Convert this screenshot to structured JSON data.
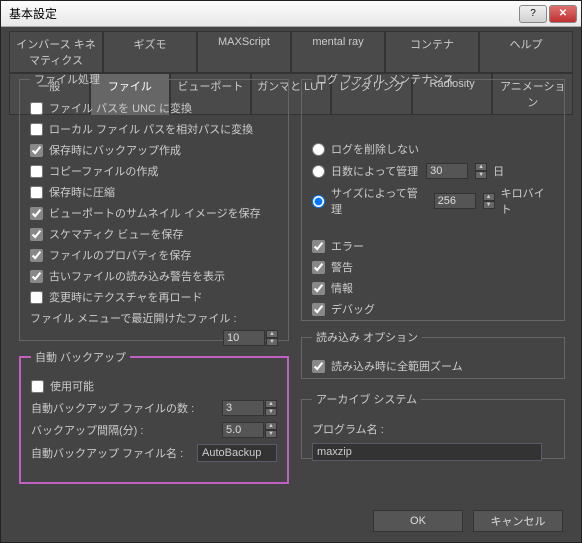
{
  "window": {
    "title": "基本設定"
  },
  "tabs_row1": [
    "インバース キネマティクス",
    "ギズモ",
    "MAXScript",
    "mental ray",
    "コンテナ",
    "ヘルプ"
  ],
  "tabs_row2": [
    "一般",
    "ファイル",
    "ビューポート",
    "ガンマと LUT",
    "レンダリング",
    "Radiosity",
    "アニメーション"
  ],
  "active_tab": "ファイル",
  "file_handling": {
    "legend": "ファイル処理",
    "items": [
      {
        "label": "ファイル パスを UNC に変換",
        "checked": false
      },
      {
        "label": "ローカル ファイル パスを相対パスに変換",
        "checked": false
      },
      {
        "label": "保存時にバックアップ作成",
        "checked": true
      },
      {
        "label": "コピーファイルの作成",
        "checked": false
      },
      {
        "label": "保存時に圧縮",
        "checked": false
      },
      {
        "label": "ビューポートのサムネイル イメージを保存",
        "checked": true
      },
      {
        "label": "スケマティク ビューを保存",
        "checked": true
      },
      {
        "label": "ファイルのプロパティを保存",
        "checked": true
      },
      {
        "label": "古いファイルの読み込み警告を表示",
        "checked": true
      },
      {
        "label": "変更時にテクスチャを再ロード",
        "checked": false
      }
    ],
    "recent_label": "ファイル メニューで最近開けたファイル :",
    "recent_value": "10"
  },
  "autobak": {
    "legend": "自動 バックアップ",
    "enable_label": "使用可能",
    "enable_checked": false,
    "count_label": "自動バックアップ ファイルの数 :",
    "count_value": "3",
    "interval_label": "バックアップ間隔(分) :",
    "interval_value": "5.0",
    "name_label": "自動バックアップ ファイル名 :",
    "name_value": "AutoBackup"
  },
  "log": {
    "legend": "ログ ファイル メンテナンス",
    "radios": [
      {
        "label": "ログを削除しない",
        "selected": false
      },
      {
        "label": "日数によって管理",
        "selected": false,
        "value": "30",
        "suffix": "日"
      },
      {
        "label": "サイズによって管理",
        "selected": true,
        "value": "256",
        "suffix": "キロバイト"
      }
    ],
    "checks": [
      {
        "label": "エラー",
        "checked": true
      },
      {
        "label": "警告",
        "checked": true
      },
      {
        "label": "情報",
        "checked": true
      },
      {
        "label": "デバッグ",
        "checked": true
      }
    ]
  },
  "import_opt": {
    "legend": "読み込み オプション",
    "zoom_label": "読み込み時に全範囲ズーム",
    "zoom_checked": true
  },
  "archive": {
    "legend": "アーカイブ システム",
    "prog_label": "プログラム名 :",
    "prog_value": "maxzip"
  },
  "buttons": {
    "ok": "OK",
    "cancel": "キャンセル"
  }
}
